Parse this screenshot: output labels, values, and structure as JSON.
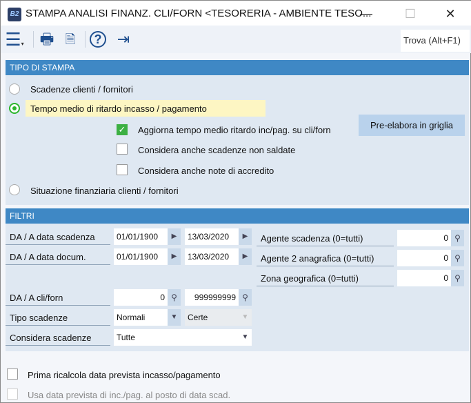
{
  "window": {
    "title": "STAMPA ANALISI FINANZ. CLI/FORN <TESORERIA - AMBIENTE TESO...",
    "logo": "B2",
    "minimize": "—",
    "maximize": "☐",
    "close": "✕"
  },
  "toolbar": {
    "search_label": "Trova (Alt+F1)"
  },
  "tipo_stampa": {
    "header": "TIPO DI STAMPA",
    "options": [
      {
        "label": "Scadenze clienti / fornitori",
        "selected": false
      },
      {
        "label": "Tempo medio di ritardo incasso / pagamento",
        "selected": true
      },
      {
        "label": "Situazione finanziaria clienti / fornitori",
        "selected": false
      }
    ],
    "checkboxes": [
      {
        "label": "Aggiorna tempo medio ritardo inc/pag. su cli/forn",
        "checked": true
      },
      {
        "label": "Considera anche scadenze non saldate",
        "checked": false
      },
      {
        "label": "Considera anche note di accredito",
        "checked": false
      }
    ],
    "pre_elabora": "Pre-elabora in griglia"
  },
  "filtri": {
    "header": "FILTRI",
    "data_scadenza": {
      "label": "DA / A data scadenza",
      "from": "01/01/1900",
      "to": "13/03/2020"
    },
    "data_docum": {
      "label": "DA / A data docum.",
      "from": "01/01/1900",
      "to": "13/03/2020"
    },
    "cli_forn": {
      "label": "DA / A cli/forn",
      "from": "0",
      "to": "999999999"
    },
    "tipo_scadenze": {
      "label": "Tipo scadenze",
      "value1": "Normali",
      "value2": "Certe"
    },
    "considera_scadenze": {
      "label": "Considera scadenze",
      "value": "Tutte"
    },
    "agente_scadenza": {
      "label": "Agente scadenza (0=tutti)",
      "value": "0"
    },
    "agente2": {
      "label": "Agente 2 anagrafica (0=tutti)",
      "value": "0"
    },
    "zona": {
      "label": "Zona geografica (0=tutti)",
      "value": "0"
    }
  },
  "bottom": {
    "ricalcola": {
      "label": "Prima ricalcola data prevista incasso/pagamento",
      "checked": false
    },
    "usa_data": {
      "label": "Usa data prevista di inc./pag. al posto di data scad.",
      "checked": false,
      "disabled": true
    }
  }
}
